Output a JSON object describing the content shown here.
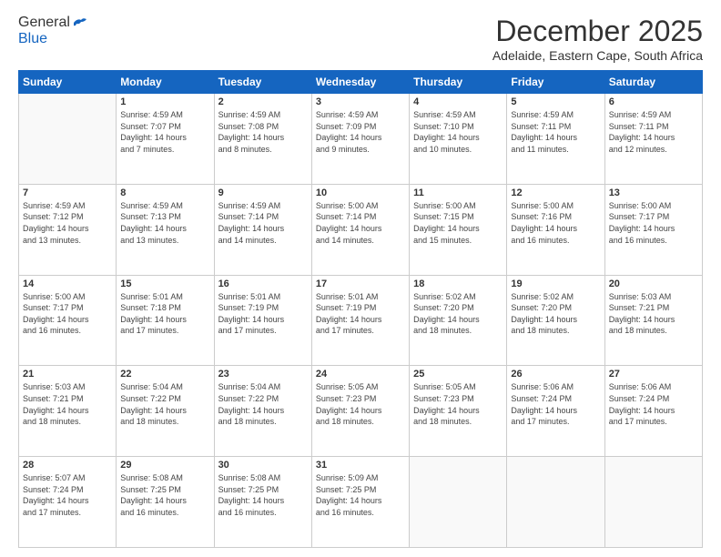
{
  "logo": {
    "general": "General",
    "blue": "Blue"
  },
  "title": "December 2025",
  "location": "Adelaide, Eastern Cape, South Africa",
  "weekdays": [
    "Sunday",
    "Monday",
    "Tuesday",
    "Wednesday",
    "Thursday",
    "Friday",
    "Saturday"
  ],
  "weeks": [
    [
      {
        "day": "",
        "info": ""
      },
      {
        "day": "1",
        "info": "Sunrise: 4:59 AM\nSunset: 7:07 PM\nDaylight: 14 hours\nand 7 minutes."
      },
      {
        "day": "2",
        "info": "Sunrise: 4:59 AM\nSunset: 7:08 PM\nDaylight: 14 hours\nand 8 minutes."
      },
      {
        "day": "3",
        "info": "Sunrise: 4:59 AM\nSunset: 7:09 PM\nDaylight: 14 hours\nand 9 minutes."
      },
      {
        "day": "4",
        "info": "Sunrise: 4:59 AM\nSunset: 7:10 PM\nDaylight: 14 hours\nand 10 minutes."
      },
      {
        "day": "5",
        "info": "Sunrise: 4:59 AM\nSunset: 7:11 PM\nDaylight: 14 hours\nand 11 minutes."
      },
      {
        "day": "6",
        "info": "Sunrise: 4:59 AM\nSunset: 7:11 PM\nDaylight: 14 hours\nand 12 minutes."
      }
    ],
    [
      {
        "day": "7",
        "info": "Sunrise: 4:59 AM\nSunset: 7:12 PM\nDaylight: 14 hours\nand 13 minutes."
      },
      {
        "day": "8",
        "info": "Sunrise: 4:59 AM\nSunset: 7:13 PM\nDaylight: 14 hours\nand 13 minutes."
      },
      {
        "day": "9",
        "info": "Sunrise: 4:59 AM\nSunset: 7:14 PM\nDaylight: 14 hours\nand 14 minutes."
      },
      {
        "day": "10",
        "info": "Sunrise: 5:00 AM\nSunset: 7:14 PM\nDaylight: 14 hours\nand 14 minutes."
      },
      {
        "day": "11",
        "info": "Sunrise: 5:00 AM\nSunset: 7:15 PM\nDaylight: 14 hours\nand 15 minutes."
      },
      {
        "day": "12",
        "info": "Sunrise: 5:00 AM\nSunset: 7:16 PM\nDaylight: 14 hours\nand 16 minutes."
      },
      {
        "day": "13",
        "info": "Sunrise: 5:00 AM\nSunset: 7:17 PM\nDaylight: 14 hours\nand 16 minutes."
      }
    ],
    [
      {
        "day": "14",
        "info": "Sunrise: 5:00 AM\nSunset: 7:17 PM\nDaylight: 14 hours\nand 16 minutes."
      },
      {
        "day": "15",
        "info": "Sunrise: 5:01 AM\nSunset: 7:18 PM\nDaylight: 14 hours\nand 17 minutes."
      },
      {
        "day": "16",
        "info": "Sunrise: 5:01 AM\nSunset: 7:19 PM\nDaylight: 14 hours\nand 17 minutes."
      },
      {
        "day": "17",
        "info": "Sunrise: 5:01 AM\nSunset: 7:19 PM\nDaylight: 14 hours\nand 17 minutes."
      },
      {
        "day": "18",
        "info": "Sunrise: 5:02 AM\nSunset: 7:20 PM\nDaylight: 14 hours\nand 18 minutes."
      },
      {
        "day": "19",
        "info": "Sunrise: 5:02 AM\nSunset: 7:20 PM\nDaylight: 14 hours\nand 18 minutes."
      },
      {
        "day": "20",
        "info": "Sunrise: 5:03 AM\nSunset: 7:21 PM\nDaylight: 14 hours\nand 18 minutes."
      }
    ],
    [
      {
        "day": "21",
        "info": "Sunrise: 5:03 AM\nSunset: 7:21 PM\nDaylight: 14 hours\nand 18 minutes."
      },
      {
        "day": "22",
        "info": "Sunrise: 5:04 AM\nSunset: 7:22 PM\nDaylight: 14 hours\nand 18 minutes."
      },
      {
        "day": "23",
        "info": "Sunrise: 5:04 AM\nSunset: 7:22 PM\nDaylight: 14 hours\nand 18 minutes."
      },
      {
        "day": "24",
        "info": "Sunrise: 5:05 AM\nSunset: 7:23 PM\nDaylight: 14 hours\nand 18 minutes."
      },
      {
        "day": "25",
        "info": "Sunrise: 5:05 AM\nSunset: 7:23 PM\nDaylight: 14 hours\nand 18 minutes."
      },
      {
        "day": "26",
        "info": "Sunrise: 5:06 AM\nSunset: 7:24 PM\nDaylight: 14 hours\nand 17 minutes."
      },
      {
        "day": "27",
        "info": "Sunrise: 5:06 AM\nSunset: 7:24 PM\nDaylight: 14 hours\nand 17 minutes."
      }
    ],
    [
      {
        "day": "28",
        "info": "Sunrise: 5:07 AM\nSunset: 7:24 PM\nDaylight: 14 hours\nand 17 minutes."
      },
      {
        "day": "29",
        "info": "Sunrise: 5:08 AM\nSunset: 7:25 PM\nDaylight: 14 hours\nand 16 minutes."
      },
      {
        "day": "30",
        "info": "Sunrise: 5:08 AM\nSunset: 7:25 PM\nDaylight: 14 hours\nand 16 minutes."
      },
      {
        "day": "31",
        "info": "Sunrise: 5:09 AM\nSunset: 7:25 PM\nDaylight: 14 hours\nand 16 minutes."
      },
      {
        "day": "",
        "info": ""
      },
      {
        "day": "",
        "info": ""
      },
      {
        "day": "",
        "info": ""
      }
    ]
  ]
}
